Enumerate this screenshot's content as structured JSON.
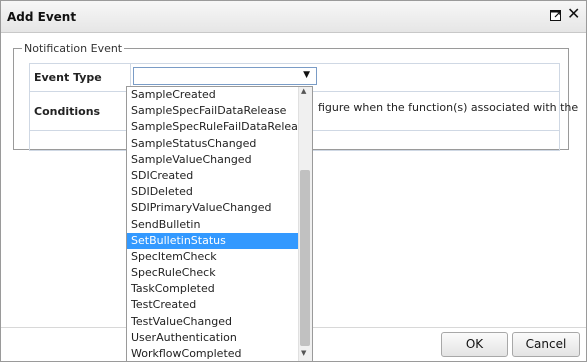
{
  "dialog": {
    "title": "Add Event"
  },
  "section": {
    "legend": "Notification Event"
  },
  "form": {
    "event_type_label": "Event Type",
    "event_type_value": "",
    "conditions_label": "Conditions",
    "conditions_text": "figure when the function(s) associated with the"
  },
  "dropdown": {
    "items": [
      "SampleCreated",
      "SampleSpecFailDataRelease",
      "SampleSpecRuleFailDataRelease",
      "SampleStatusChanged",
      "SampleValueChanged",
      "SDICreated",
      "SDIDeleted",
      "SDIPrimaryValueChanged",
      "SendBulletin",
      "SetBulletinStatus",
      "SpecItemCheck",
      "SpecRuleCheck",
      "TaskCompleted",
      "TestCreated",
      "TestValueChanged",
      "UserAuthentication",
      "WorkflowCompleted"
    ],
    "selected_index": 9
  },
  "buttons": {
    "ok": "OK",
    "cancel": "Cancel"
  },
  "colors": {
    "selection": "#3399ff",
    "border": "#9a9a9a"
  }
}
